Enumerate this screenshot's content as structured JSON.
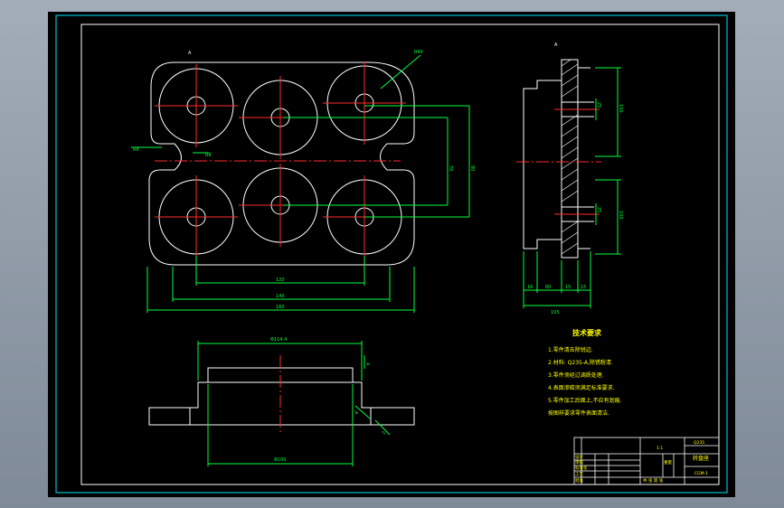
{
  "drawing": {
    "tech_req": {
      "title": "技术要求",
      "items": [
        "1.零件清去除锐边.",
        "2.材料: Q235-A,除锈粉清.",
        "3.零件须经过调质处理.",
        "4.表面渗碳须满足标准要求.",
        "5.零件加工后面上,不应有划痕.",
        "按图样要求零件表面清洁."
      ]
    },
    "dimensions": {
      "top_r": "R40",
      "left_r": "R8",
      "mid_r": "R8",
      "dim_v_inner": "70",
      "dim_v_outer": "80",
      "dim_h1": "120",
      "dim_h2": "140",
      "dim_h3": "160",
      "side_total": "105",
      "side_a": "16",
      "side_b": "60",
      "side_c": "15",
      "side_d": "15",
      "side_h1": "100",
      "side_h2": "100",
      "side_s1": "25",
      "side_s2": "25",
      "front_top": "Φ114.4",
      "front_bot": "Φ100",
      "front_r1": "4",
      "front_r2": "4",
      "front_r3": "2"
    },
    "title_block": {
      "part_name": "转盘座",
      "material": "Q235",
      "scale": "1:1",
      "doc": "CGM-1",
      "designer": "设计",
      "checker": "审核",
      "std": "标准化",
      "process": "工艺",
      "approve": "批准",
      "weight": "重量",
      "sheets": "共 张 第 张"
    },
    "markers": {
      "top_a": "A",
      "top_b": "A"
    }
  }
}
